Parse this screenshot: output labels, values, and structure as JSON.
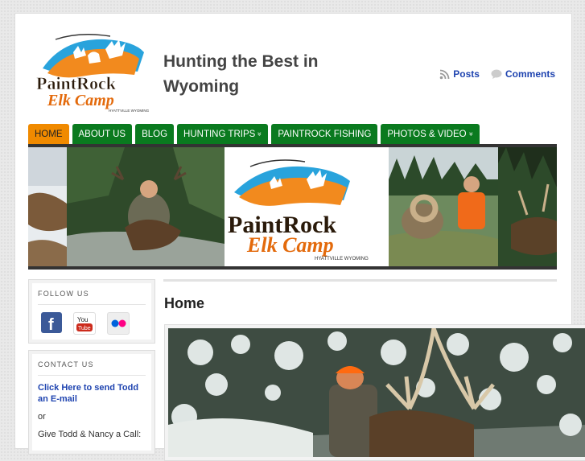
{
  "header": {
    "logo_line1": "PaintRock",
    "logo_line2": "Elk Camp",
    "logo_sub": "HYATTVILLE WYOMING",
    "site_title": "Hunting the Best in Wyoming",
    "feeds": {
      "posts_label": "Posts",
      "comments_label": "Comments"
    }
  },
  "nav": {
    "items": [
      {
        "label": "HOME",
        "active": true,
        "has_submenu": false
      },
      {
        "label": "ABOUT US",
        "active": false,
        "has_submenu": false
      },
      {
        "label": "BLOG",
        "active": false,
        "has_submenu": false
      },
      {
        "label": "HUNTING TRIPS",
        "active": false,
        "has_submenu": true
      },
      {
        "label": "PAINTROCK FISHING",
        "active": false,
        "has_submenu": false
      },
      {
        "label": "PHOTOS & VIDEO",
        "active": false,
        "has_submenu": true
      }
    ],
    "submenu_glyph": "»"
  },
  "banner": {
    "logo_line1": "PaintRock",
    "logo_line2": "Elk Camp",
    "logo_sub": "HYATTVILLE WYOMING"
  },
  "sidebar": {
    "follow_title": "FOLLOW US",
    "social": [
      {
        "icon": "facebook-icon",
        "color": "#3b5998"
      },
      {
        "icon": "youtube-icon",
        "color": "#cc2b1c"
      },
      {
        "icon": "flickr-icon",
        "color": "#eeeeee"
      }
    ],
    "contact_title": "CONTACT US",
    "contact_link": "Click Here to send Todd an E-mail",
    "contact_or": "or",
    "contact_call": "Give Todd & Nancy a Call:"
  },
  "main": {
    "page_title": "Home"
  },
  "colors": {
    "nav_green": "#0a7a1f",
    "nav_active": "#f08a00",
    "link_blue": "#1f44b0"
  }
}
